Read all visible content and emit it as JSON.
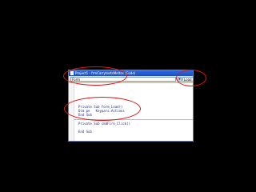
{
  "window": {
    "title": "Project1 - frmCarrytestsMeltsx (Code)",
    "object_select_value": "Form",
    "procedure_select_value": "Load"
  },
  "code": {
    "lines": [
      "Private Sub Form_Load()",
      "End Sub",
      "Private Sub cmdFire_Click()",
      "End Sub"
    ],
    "inserted_line": "Dim pe   Keypars.Actions"
  },
  "colors": {
    "background": "#000000",
    "highlight_ellipse": "#e01515",
    "titlebar": "#2f6be0"
  }
}
